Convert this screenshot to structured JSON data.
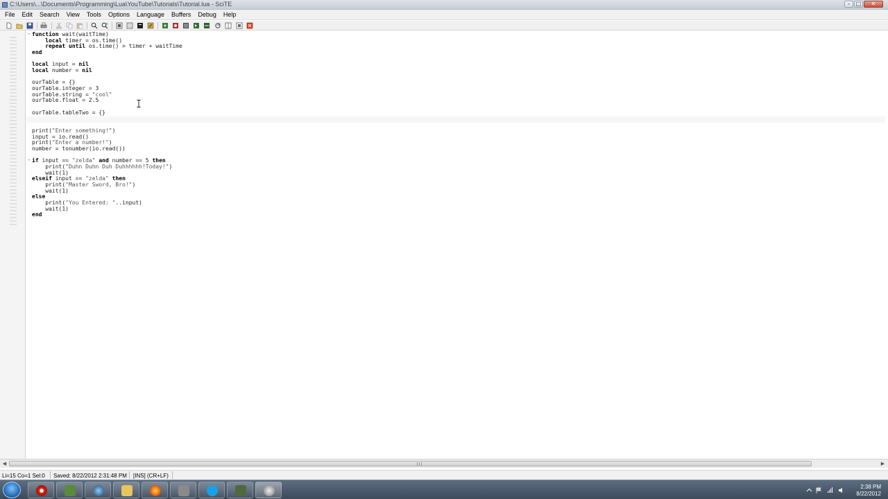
{
  "window": {
    "title": "C:\\Users\\...\\Documents\\Programming\\Lua\\YouTube\\Tutorials\\Tutorial.lua - SciTE"
  },
  "menu": [
    "File",
    "Edit",
    "Search",
    "View",
    "Tools",
    "Options",
    "Language",
    "Buffers",
    "Debug",
    "Help"
  ],
  "toolbar_icons": [
    "new-file-icon",
    "open-icon",
    "save-icon",
    "print-icon",
    "cut-icon",
    "copy-icon",
    "paste-icon",
    "find-icon",
    "replace-icon",
    "compile-icon",
    "build-icon",
    "go-icon",
    "stop-icon",
    "macro-icon",
    "tool-icon"
  ],
  "code_lines": [
    {
      "fold": "-",
      "text": "function wait(waitTime)"
    },
    {
      "text": "    local timer = os.time()"
    },
    {
      "text": "    repeat until os.time() > timer + waitTime"
    },
    {
      "text": "end"
    },
    {
      "text": ""
    },
    {
      "text": "local input = nil"
    },
    {
      "text": "local number = nil"
    },
    {
      "text": ""
    },
    {
      "text": "ourTable = {}"
    },
    {
      "text": "ourTable.integer = 3"
    },
    {
      "text": "ourTable.string = \"cool\""
    },
    {
      "text": "ourTable.float = 2.5"
    },
    {
      "text": ""
    },
    {
      "text": "ourTable.tableTwo = {}"
    },
    {
      "text": ""
    },
    {
      "text": ""
    },
    {
      "text": "print(\"Enter something!\")"
    },
    {
      "text": "input = io.read()"
    },
    {
      "text": "print(\"Enter a number!\")"
    },
    {
      "text": "number = tonumber(io.read())"
    },
    {
      "text": ""
    },
    {
      "fold": "-",
      "text": "if input == \"zelda\" and number == 5 then"
    },
    {
      "text": "    print(\"Duhn Duhn Duh Duhhhhhh!Today!\")"
    },
    {
      "text": "    wait(1)"
    },
    {
      "text": "elseif input == \"zelda\" then"
    },
    {
      "text": "    print(\"Master Sword, Bro!\")"
    },
    {
      "text": "    wait(1)"
    },
    {
      "text": "else"
    },
    {
      "text": "    print(\"You Entered: \"..input)"
    },
    {
      "text": "    wait(1)"
    },
    {
      "text": "end"
    }
  ],
  "status": {
    "position": "Li=15 Co=1 Sel:0",
    "saved": "Saved: 8/22/2012 2:31:48 PM",
    "mode": "[INS] (CR+LF)"
  },
  "taskbar": {
    "time": "2:38 PM",
    "date": "8/22/2012",
    "apps": [
      "opera-icon",
      "minecraft-icon",
      "globe-icon",
      "folder-icon",
      "firefox-icon",
      "app-icon",
      "skype-icon",
      "tool-icon",
      "scite-icon"
    ]
  },
  "colors": {
    "keyword": "#000000",
    "text": "#222222",
    "margin": "#f4f4f4",
    "taskbar": "#4a5868"
  }
}
